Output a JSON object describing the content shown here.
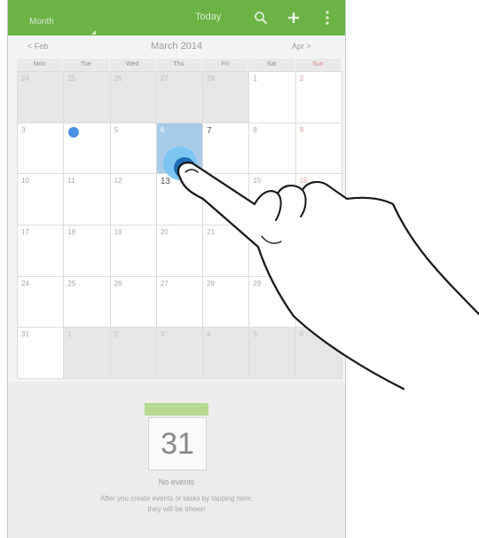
{
  "action_bar": {
    "view_label": "Month",
    "today_label": "Today",
    "search_icon": "search-icon",
    "add_icon": "add-icon",
    "more_icon": "overflow-menu-icon",
    "bar_color": "#6bb344"
  },
  "month_nav": {
    "prev": "< Feb",
    "title": "March 2014",
    "next": "Apr >"
  },
  "weekdays": [
    "Mon",
    "Tue",
    "Wed",
    "Thu",
    "Fri",
    "Sat",
    "Sun"
  ],
  "weeks": [
    [
      "24",
      "25",
      "26",
      "27",
      "28",
      "1",
      "2"
    ],
    [
      "3",
      "4",
      "5",
      "6",
      "7",
      "8",
      "9"
    ],
    [
      "10",
      "11",
      "12",
      "13",
      "14",
      "15",
      "16"
    ],
    [
      "17",
      "18",
      "19",
      "20",
      "21",
      "22",
      "23"
    ],
    [
      "24",
      "25",
      "26",
      "27",
      "28",
      "29",
      "30"
    ],
    [
      "31",
      "1",
      "2",
      "3",
      "4",
      "5",
      "6"
    ]
  ],
  "selected_day": "6",
  "empty_state": {
    "day": "31",
    "title": "No events",
    "hint": "After you create events or tasks by tapping here, they will be shown"
  }
}
